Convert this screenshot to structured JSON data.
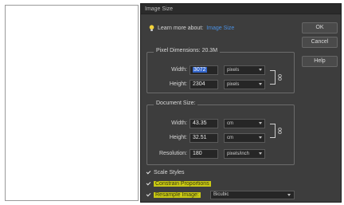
{
  "dialog": {
    "title": "Image Size",
    "learn_text": "Learn more about:",
    "learn_link": "Image Size"
  },
  "buttons": {
    "ok": "OK",
    "cancel": "Cancel",
    "help": "Help"
  },
  "pixel_dimensions": {
    "title": "Pixel Dimensions: 20.3M",
    "width_label": "Width:",
    "width_value": "3072",
    "width_unit": "pixels",
    "height_label": "Height:",
    "height_value": "2304",
    "height_unit": "pixels"
  },
  "document_size": {
    "title": "Document Size:",
    "width_label": "Width:",
    "width_value": "43.35",
    "width_unit": "cm",
    "height_label": "Height:",
    "height_value": "32.51",
    "height_unit": "cm",
    "resolution_label": "Resolution:",
    "resolution_value": "180",
    "resolution_unit": "pixels/inch"
  },
  "options": {
    "scale_styles": "Scale Styles",
    "constrain_proportions": "Constrain Proportions",
    "resample_image": "Resample Image:",
    "resample_method": "Bicubic",
    "scale_styles_checked": true,
    "constrain_checked": true,
    "resample_checked": true
  },
  "colors": {
    "dialog_bg": "#3d3d3d",
    "highlight": "#c8c814",
    "link": "#4a8fe0",
    "selection": "#3366cc"
  }
}
